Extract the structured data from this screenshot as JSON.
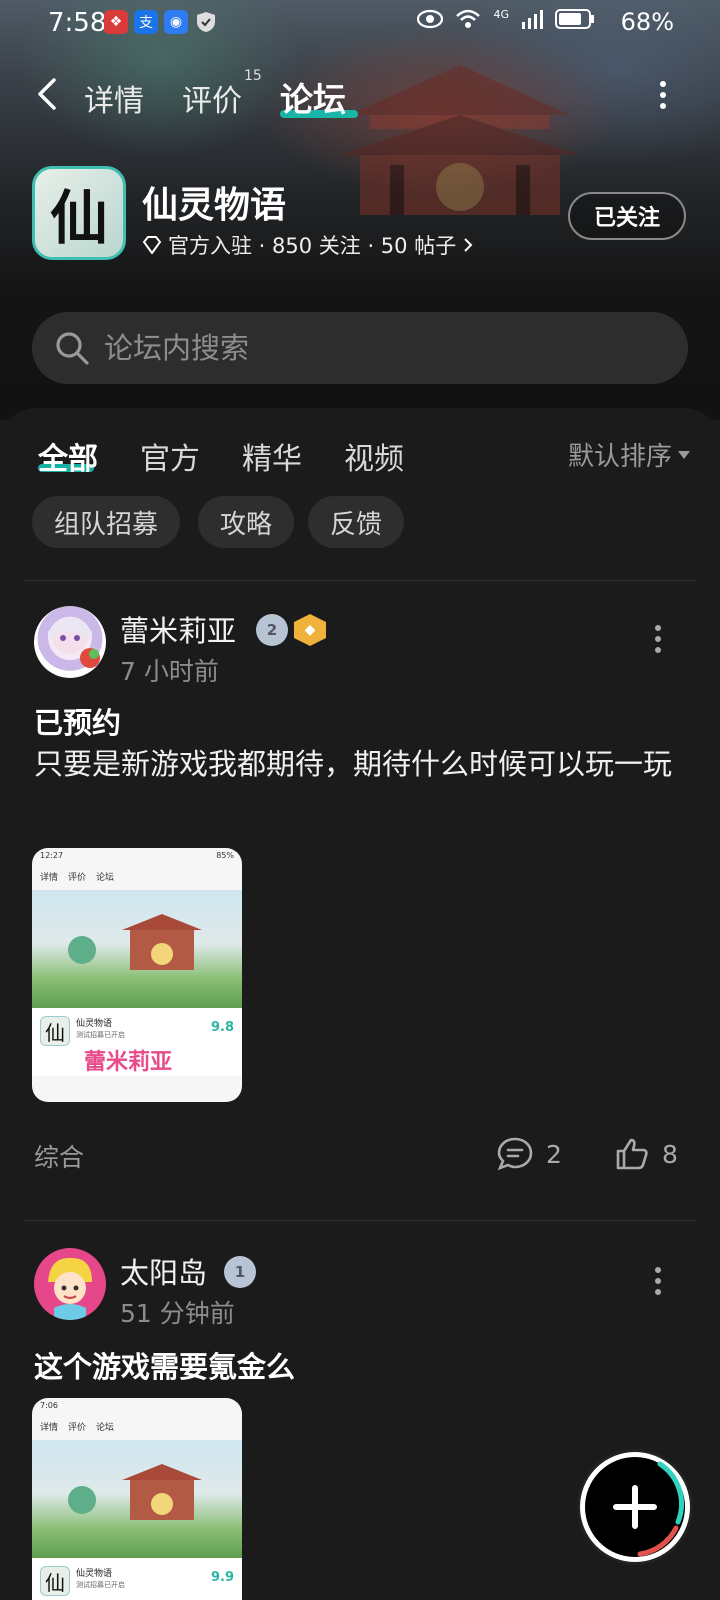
{
  "status_bar": {
    "time": "7:58",
    "network": "4G",
    "battery": "68%"
  },
  "nav": {
    "tabs": [
      {
        "label": "详情"
      },
      {
        "label": "评价",
        "badge": "15"
      },
      {
        "label": "论坛"
      }
    ],
    "active_tab": "论坛"
  },
  "game": {
    "icon_char": "仙",
    "title": "仙灵物语",
    "meta": "官方入驻 · 850 关注 · 50 帖子",
    "follow_label": "已关注"
  },
  "search": {
    "placeholder": "论坛内搜索"
  },
  "filter_tabs": [
    "全部",
    "官方",
    "精华",
    "视频"
  ],
  "sort_label": "默认排序",
  "chips": [
    "组队招募",
    "攻略",
    "反馈"
  ],
  "posts": [
    {
      "username": "蕾米莉亚",
      "level_badge": "2",
      "time": "7 小时前",
      "title": "已预约",
      "body": "只要是新游戏我都期待，期待什么时候可以玩一玩",
      "tag": "综合",
      "comments": "2",
      "likes": "8",
      "thumb": {
        "time": "12:27",
        "battery": "85%",
        "tabs": [
          "详情",
          "评价",
          "论坛"
        ],
        "game_title": "仙灵物语",
        "subtitle": "测试招募已开启",
        "score": "9.8",
        "watermark": "蕾米莉亚"
      }
    },
    {
      "username": "太阳岛",
      "level_badge": "1",
      "time": "51 分钟前",
      "title": "这个游戏需要氪金么",
      "thumb": {
        "time": "7:06",
        "tabs": [
          "详情",
          "评价",
          "论坛"
        ],
        "game_title": "仙灵物语",
        "subtitle": "测试招募已开启",
        "score": "9.9"
      }
    }
  ],
  "colors": {
    "accent": "#15c3b2",
    "background": "#1b1b1b",
    "gold": "#f0b23c"
  }
}
